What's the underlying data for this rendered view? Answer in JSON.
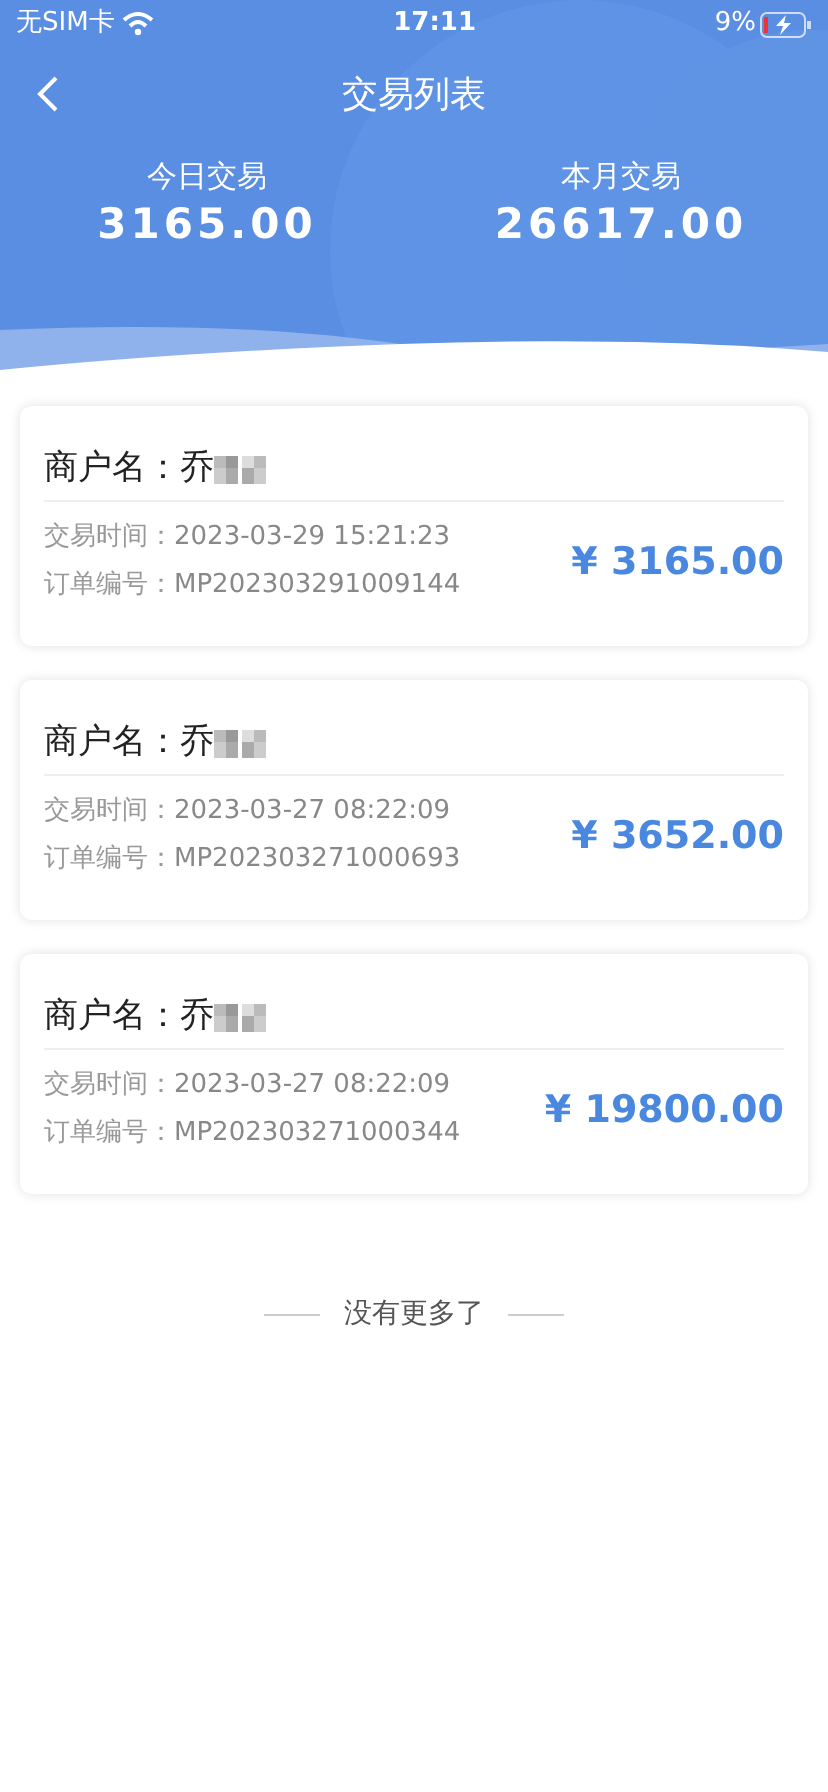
{
  "status_bar": {
    "carrier": "无SIM卡",
    "time": "17:11",
    "battery": "9%"
  },
  "nav": {
    "title": "交易列表"
  },
  "summary": [
    {
      "label": "今日交易",
      "value": "3165.00"
    },
    {
      "label": "本月交易",
      "value": "26617.00"
    }
  ],
  "transactions": [
    {
      "merchant_label": "商户名：",
      "merchant_name": "乔",
      "time_label": "交易时间：",
      "time": "2023-03-29 15:21:23",
      "order_label": "订单编号：",
      "order": "MP202303291009144",
      "amount": "¥ 3165.00"
    },
    {
      "merchant_label": "商户名：",
      "merchant_name": "乔",
      "time_label": "交易时间：",
      "time": "2023-03-27 08:22:09",
      "order_label": "订单编号：",
      "order": "MP202303271000693",
      "amount": "¥ 3652.00"
    },
    {
      "merchant_label": "商户名：",
      "merchant_name": "乔",
      "time_label": "交易时间：",
      "time": "2023-03-27 08:22:09",
      "order_label": "订单编号：",
      "order": "MP202303271000344",
      "amount": "¥ 19800.00"
    }
  ],
  "footer": "没有更多了"
}
